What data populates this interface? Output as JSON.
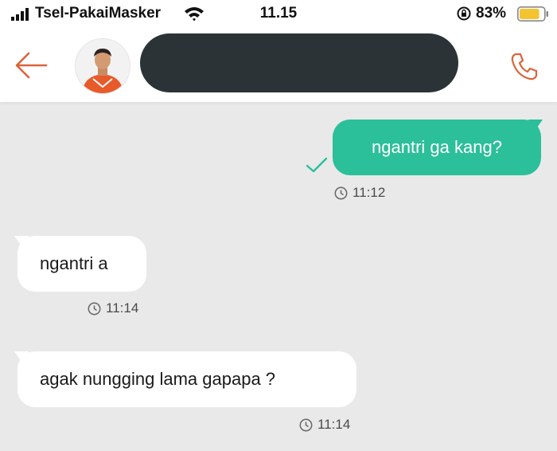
{
  "status_bar": {
    "carrier": "Tsel-PakaiMasker",
    "time": "11.15",
    "battery_percent": "83%",
    "battery_level": 0.83,
    "battery_color": "#f4c430",
    "icons": [
      "signal-icon",
      "wifi-icon",
      "orientation-lock-icon",
      "battery-icon"
    ]
  },
  "header": {
    "back_icon": "back-arrow-icon",
    "call_icon": "phone-icon",
    "accent_color": "#d9653b",
    "contact_name_redacted": true
  },
  "messages": [
    {
      "direction": "outgoing",
      "text": "ngantri ga kang?",
      "time": "11:12",
      "status": "sent",
      "bubble_color": "#2bbf9a"
    },
    {
      "direction": "incoming",
      "text": "ngantri a",
      "time": "11:14",
      "bubble_color": "#ffffff"
    },
    {
      "direction": "incoming",
      "text": "agak nungging lama gapapa ?",
      "time": "11:14",
      "bubble_color": "#ffffff"
    }
  ]
}
